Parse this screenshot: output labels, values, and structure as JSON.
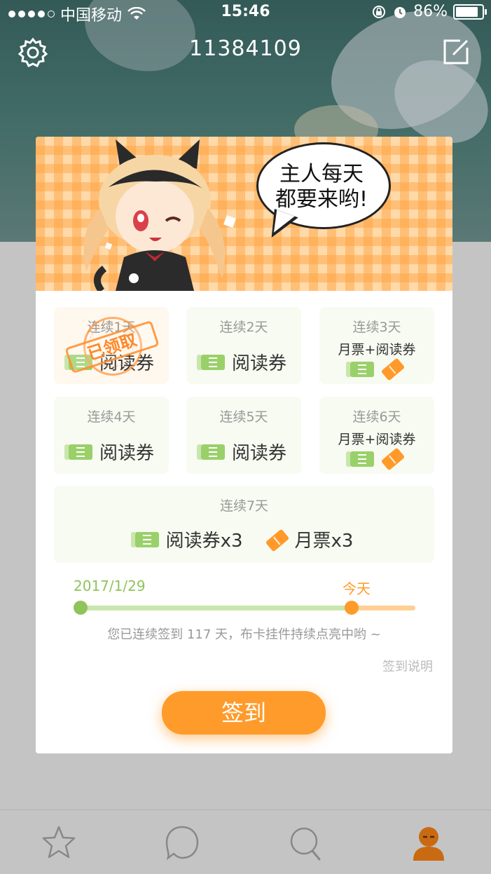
{
  "status_bar": {
    "carrier": "中国移动",
    "time": "15:46",
    "battery": "86%",
    "battery_level": 0.86
  },
  "header": {
    "user_id": "11384109",
    "settings_icon": "gear-icon",
    "edit_icon": "edit-icon"
  },
  "banner": {
    "speech_line1": "主人每天",
    "speech_line2": "都要来哟!"
  },
  "days": [
    {
      "day": "连续1天",
      "reward": "阅读券",
      "claimed": true,
      "stamp": "已领取"
    },
    {
      "day": "连续2天",
      "reward": "阅读券"
    },
    {
      "day": "连续3天",
      "reward": "月票+阅读券"
    },
    {
      "day": "连续4天",
      "reward": "阅读券"
    },
    {
      "day": "连续5天",
      "reward": "阅读券"
    },
    {
      "day": "连续6天",
      "reward": "月票+阅读券"
    }
  ],
  "day7": {
    "day": "连续7天",
    "reward1": "阅读券x3",
    "reward2": "月票x3"
  },
  "progress": {
    "start_date": "2017/1/29",
    "today_label": "今天",
    "fraction": 0.81,
    "streak_text": "您已连续签到 117 天，布卡挂件持续点亮中哟 ~"
  },
  "rules_link": "签到说明",
  "sign_button": "签到",
  "colors": {
    "accent": "#ff9b2a",
    "green": "#8fc45b",
    "light_green": "#c9e6ae"
  },
  "tabbar": [
    "star-icon",
    "chat-bubble-icon",
    "search-icon",
    "profile-icon"
  ]
}
